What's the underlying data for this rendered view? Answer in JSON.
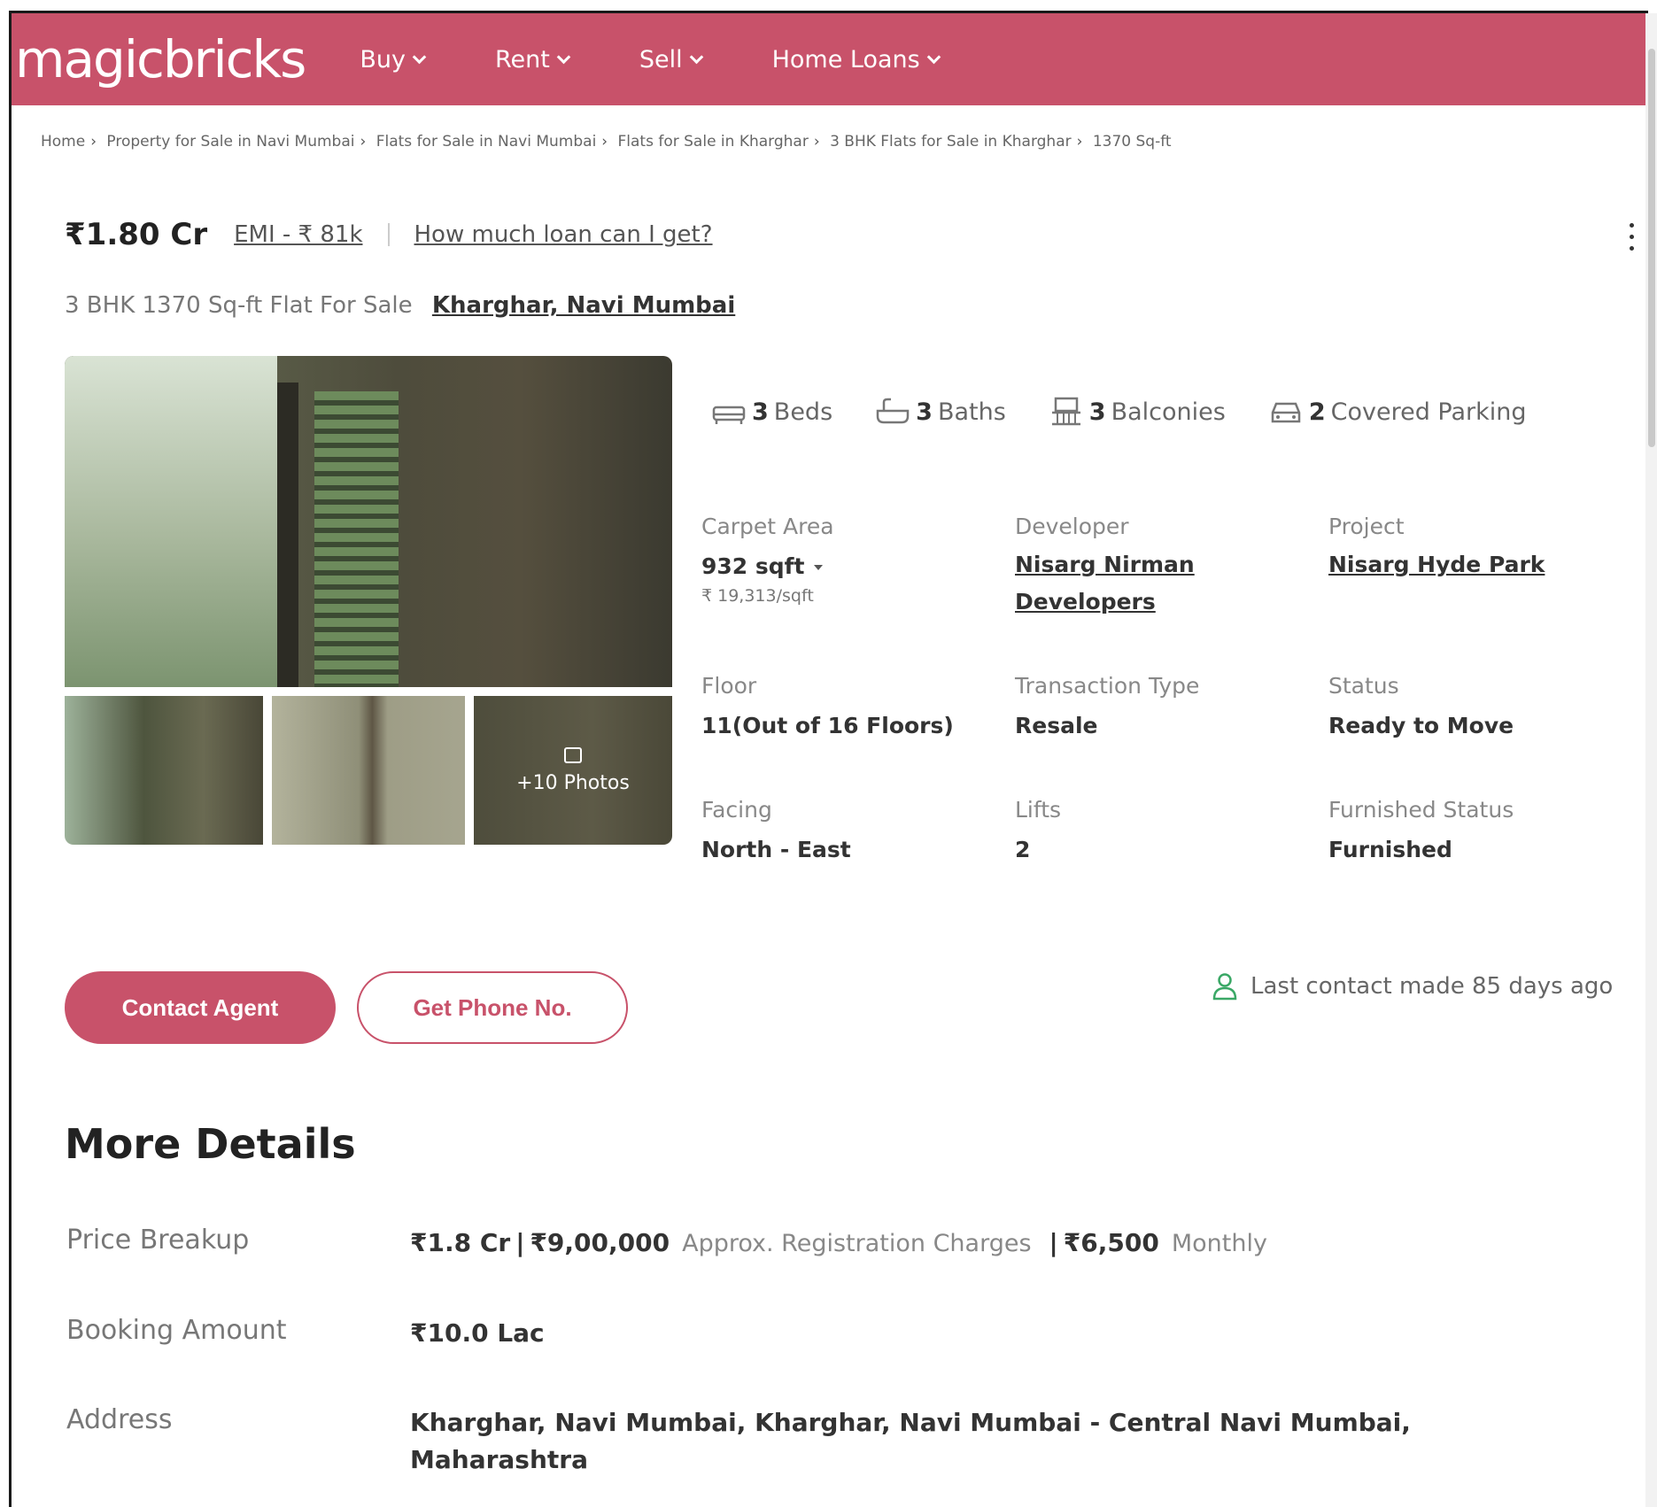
{
  "header": {
    "logo": "magicbricks",
    "nav": [
      "Buy",
      "Rent",
      "Sell",
      "Home Loans"
    ],
    "brand_color": "#c8526a"
  },
  "breadcrumb": [
    "Home",
    "Property for Sale in Navi Mumbai",
    "Flats for Sale in Navi Mumbai",
    "Flats for Sale in Kharghar",
    "3 BHK Flats for Sale in Kharghar",
    "1370 Sq-ft"
  ],
  "listing": {
    "price": "₹1.80 Cr",
    "emi": "EMI - ₹ 81k",
    "loan_link": "How much loan can I get?",
    "title": "3 BHK 1370 Sq-ft Flat For Sale",
    "location": "Kharghar, Navi Mumbai"
  },
  "gallery": {
    "more_photos": "+10 Photos"
  },
  "amenities": {
    "beds": {
      "count": "3",
      "label": "Beds",
      "icon": "bed-icon"
    },
    "baths": {
      "count": "3",
      "label": "Baths",
      "icon": "bathtub-icon"
    },
    "balconies": {
      "count": "3",
      "label": "Balconies",
      "icon": "balcony-icon"
    },
    "parking": {
      "count": "2",
      "label": "Covered Parking",
      "icon": "car-icon"
    }
  },
  "specs": {
    "carpet_area": {
      "label": "Carpet Area",
      "value": "932 sqft",
      "sub": "₹ 19,313/sqft"
    },
    "developer": {
      "label": "Developer",
      "value": "Nisarg Nirman Developers"
    },
    "project": {
      "label": "Project",
      "value": "Nisarg Hyde Park"
    },
    "floor": {
      "label": "Floor",
      "value": "11(Out of 16 Floors)"
    },
    "transaction": {
      "label": "Transaction Type",
      "value": "Resale"
    },
    "status": {
      "label": "Status",
      "value": "Ready to Move"
    },
    "facing": {
      "label": "Facing",
      "value": "North - East"
    },
    "lifts": {
      "label": "Lifts",
      "value": "2"
    },
    "furnished": {
      "label": "Furnished Status",
      "value": "Furnished"
    }
  },
  "actions": {
    "contact_agent": "Contact Agent",
    "get_phone": "Get Phone No.",
    "last_contact": "Last contact made 85 days ago"
  },
  "more_details": {
    "title": "More Details",
    "price_breakup": {
      "label": "Price Breakup",
      "price": "₹1.8 Cr",
      "registration": "₹9,00,000",
      "registration_note": "Approx. Registration Charges",
      "maintenance": "₹6,500",
      "maintenance_note": "Monthly"
    },
    "booking": {
      "label": "Booking Amount",
      "value": "₹10.0 Lac"
    },
    "address": {
      "label": "Address",
      "value": "Kharghar, Navi Mumbai, Kharghar, Navi Mumbai - Central Navi Mumbai, Maharashtra"
    }
  }
}
